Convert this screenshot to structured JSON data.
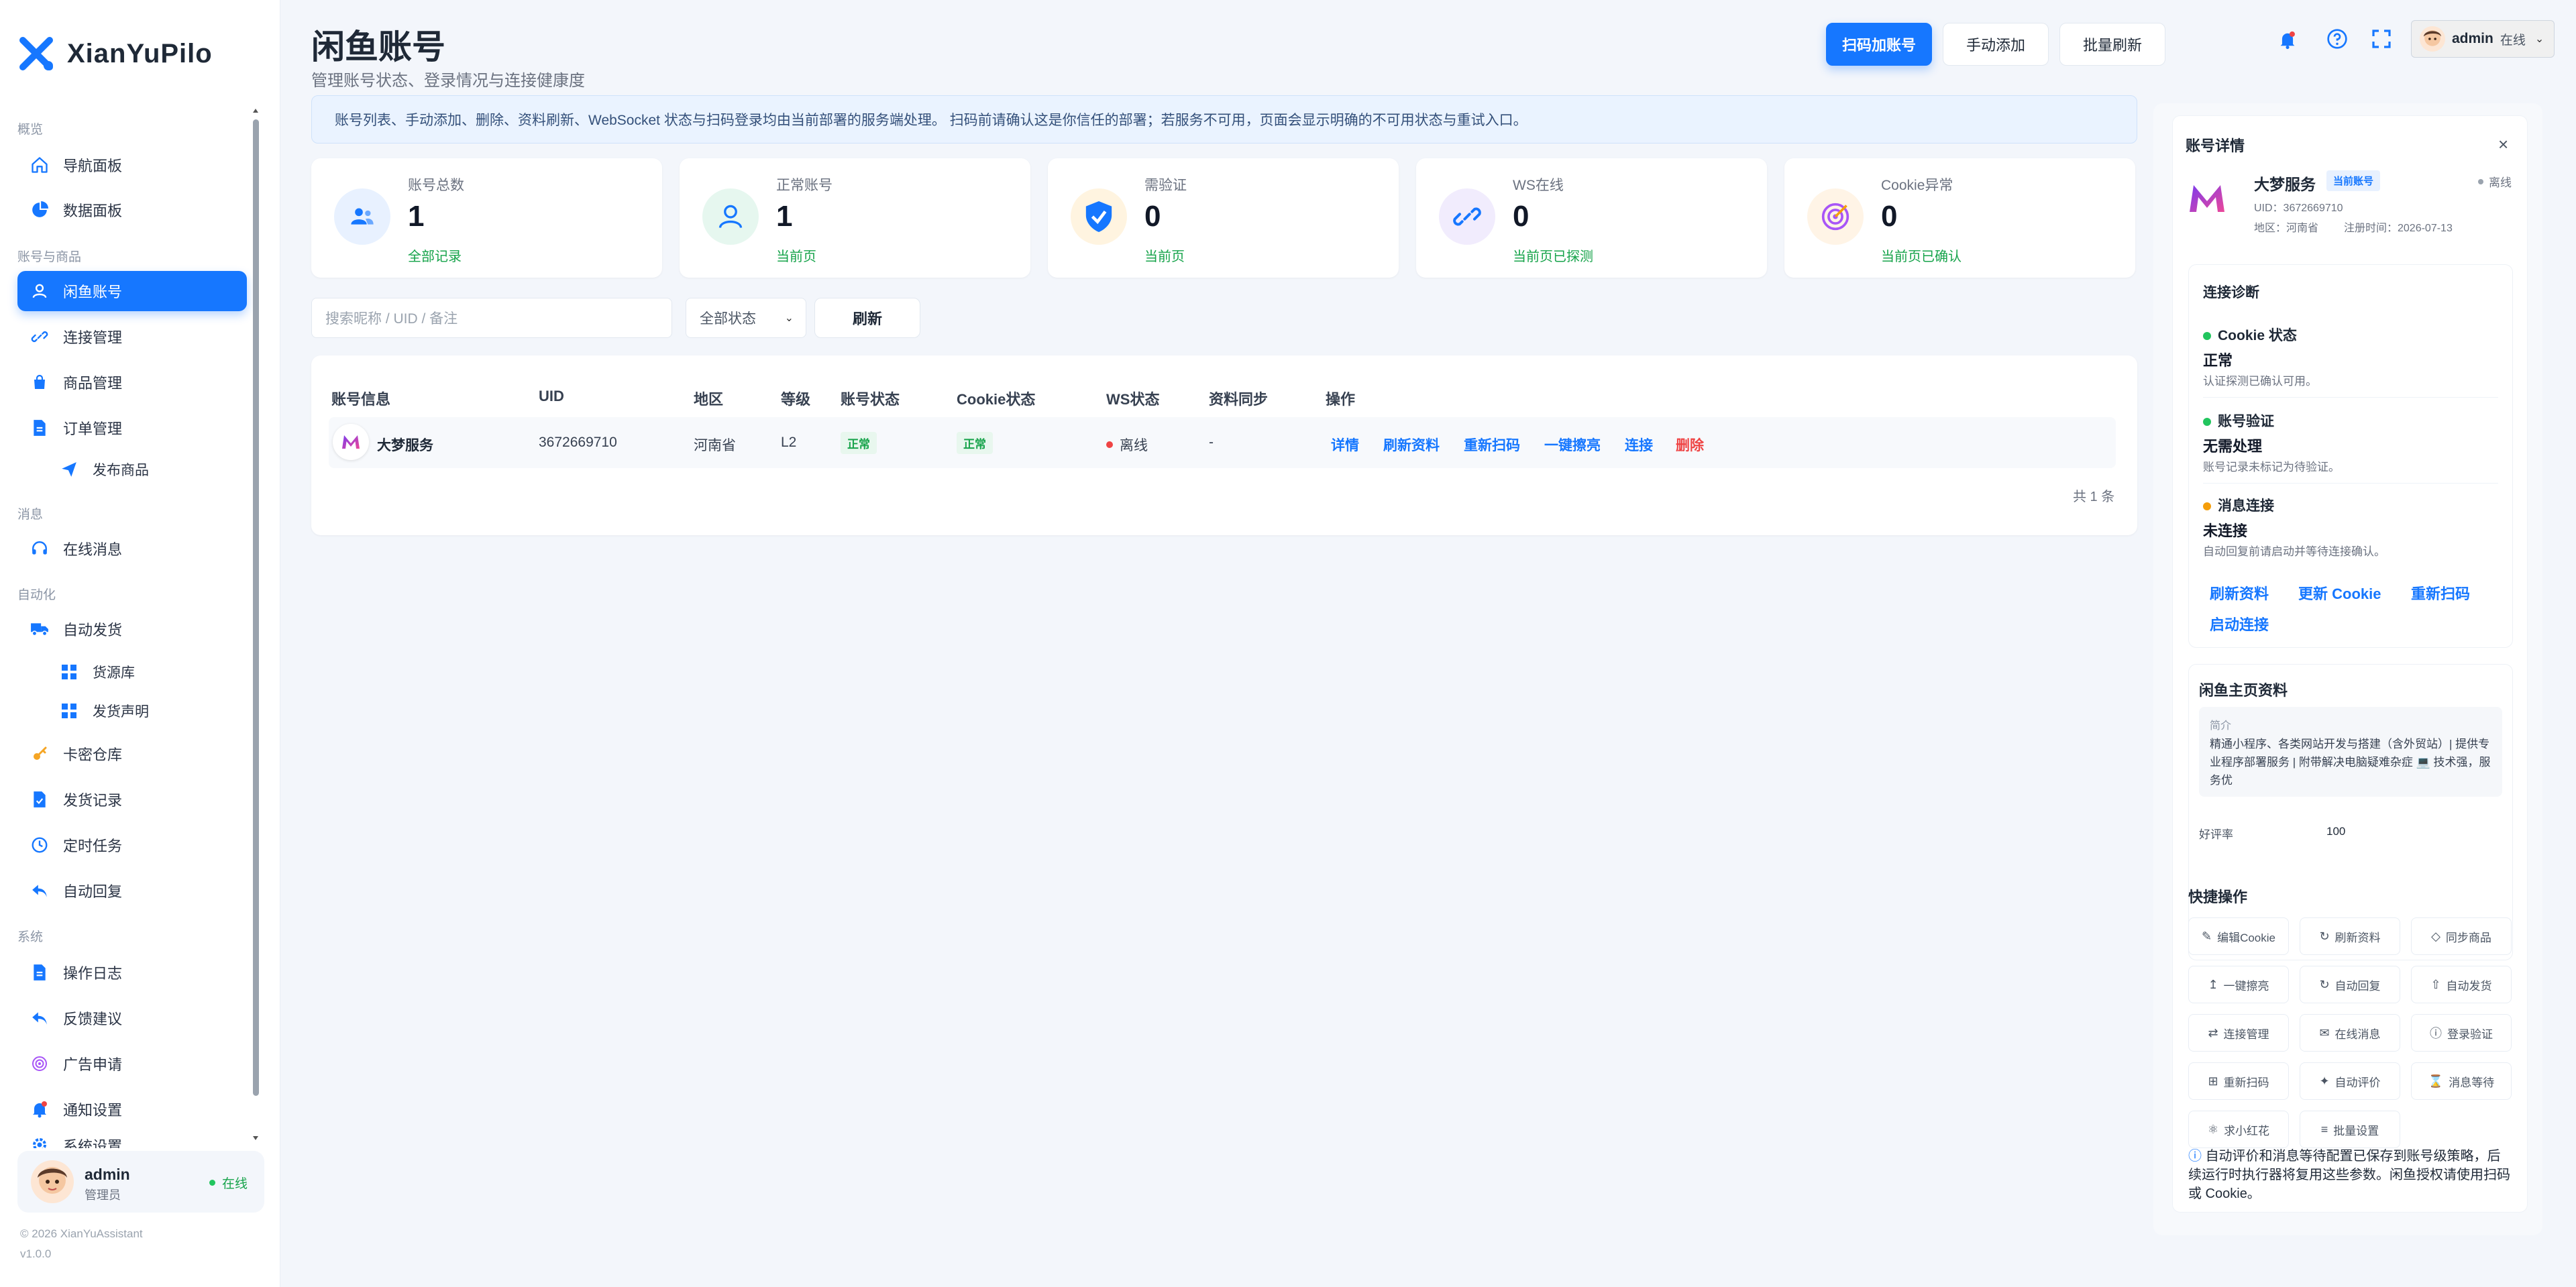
{
  "app": {
    "name": "XianYuPilo",
    "copyright": "© 2026 XianYuAssistant",
    "version": "v1.0.0"
  },
  "sidebar": {
    "sections": {
      "overview": "概览",
      "accounts": "账号与商品",
      "messages": "消息",
      "automation": "自动化",
      "system": "系统"
    },
    "items": {
      "nav_panel": "导航面板",
      "data_panel": "数据面板",
      "xianyu_accounts": "闲鱼账号",
      "connections": "连接管理",
      "products": "商品管理",
      "orders": "订单管理",
      "publish": "发布商品",
      "online_msg": "在线消息",
      "auto_delivery": "自动发货",
      "supply": "货源库",
      "delivery_statement": "发货声明",
      "card_store": "卡密仓库",
      "delivery_log": "发货记录",
      "scheduled": "定时任务",
      "auto_reply": "自动回复",
      "op_log": "操作日志",
      "feedback": "反馈建议",
      "ad_apply": "广告申请",
      "notify": "通知设置",
      "sys_settings": "系统设置"
    },
    "user": {
      "name": "admin",
      "role": "管理员",
      "status": "在线"
    }
  },
  "header": {
    "title": "闲鱼账号",
    "subtitle": "管理账号状态、登录情况与连接健康度",
    "buttons": {
      "scan_add": "扫码加账号",
      "manual_add": "手动添加",
      "batch_refresh": "批量刷新"
    },
    "user": {
      "name": "admin",
      "status": "在线"
    }
  },
  "notice": "账号列表、手动添加、删除、资料刷新、WebSocket 状态与扫码登录均由当前部署的服务端处理。 扫码前请确认这是你信任的部署；若服务不可用，页面会显示明确的不可用状态与重试入口。",
  "stats": [
    {
      "label": "账号总数",
      "value": "1",
      "foot": "全部记录"
    },
    {
      "label": "正常账号",
      "value": "1",
      "foot": "当前页"
    },
    {
      "label": "需验证",
      "value": "0",
      "foot": "当前页"
    },
    {
      "label": "WS在线",
      "value": "0",
      "foot": "当前页已探测"
    },
    {
      "label": "Cookie异常",
      "value": "0",
      "foot": "当前页已确认"
    }
  ],
  "filters": {
    "search_placeholder": "搜索昵称 / UID / 备注",
    "status_select": "全部状态",
    "refresh": "刷新"
  },
  "table": {
    "headers": [
      "账号信息",
      "UID",
      "地区",
      "等级",
      "账号状态",
      "Cookie状态",
      "WS状态",
      "资料同步",
      "操作"
    ],
    "row": {
      "name": "大梦服务",
      "uid": "3672669710",
      "region": "河南省",
      "level": "L2",
      "account_status": "正常",
      "cookie_status": "正常",
      "ws_status": "离线",
      "sync": "-",
      "actions": [
        "详情",
        "刷新资料",
        "重新扫码",
        "一键擦亮",
        "连接",
        "删除"
      ]
    },
    "total": "共 1 条"
  },
  "detail": {
    "title": "账号详情",
    "name": "大梦服务",
    "badge": "当前账号",
    "status": "离线",
    "uid_line": "UID：3672669710",
    "region_line": "地区：河南省",
    "reg_line": "注册时间：2026-07-13",
    "diag": {
      "title": "连接诊断",
      "items": [
        {
          "title": "Cookie 状态",
          "value": "正常",
          "desc": "认证探测已确认可用。",
          "color": "#22c55e"
        },
        {
          "title": "账号验证",
          "value": "无需处理",
          "desc": "账号记录未标记为待验证。",
          "color": "#22c55e"
        },
        {
          "title": "消息连接",
          "value": "未连接",
          "desc": "自动回复前请启动并等待连接确认。",
          "color": "#f59e0b"
        }
      ],
      "links": [
        "刷新资料",
        "更新 Cookie",
        "重新扫码",
        "启动连接"
      ]
    },
    "profile": {
      "title": "闲鱼主页资料",
      "intro_label": "简介",
      "intro": "精通小程序、各类网站开发与搭建（含外贸站）| 提供专业程序部署服务 | 附带解决电脑疑难杂症 💻 技术强，服务优",
      "rate_label": "好评率",
      "rate": "100"
    },
    "quick": {
      "title": "快捷操作",
      "items": [
        "编辑Cookie",
        "刷新资料",
        "同步商品",
        "一键擦亮",
        "自动回复",
        "自动发货",
        "连接管理",
        "在线消息",
        "登录验证",
        "重新扫码",
        "自动评价",
        "消息等待",
        "求小红花",
        "批量设置"
      ],
      "icons": [
        "✎",
        "↻",
        "◇",
        "↥",
        "↻",
        "⇧",
        "⇄",
        "✉",
        "ⓘ",
        "⊞",
        "✦",
        "⌛",
        "⚛",
        "≡"
      ],
      "note": "自动评价和消息等待配置已保存到账号级策略，后续运行时执行器将复用这些参数。闲鱼授权请使用扫码或 Cookie。"
    }
  }
}
